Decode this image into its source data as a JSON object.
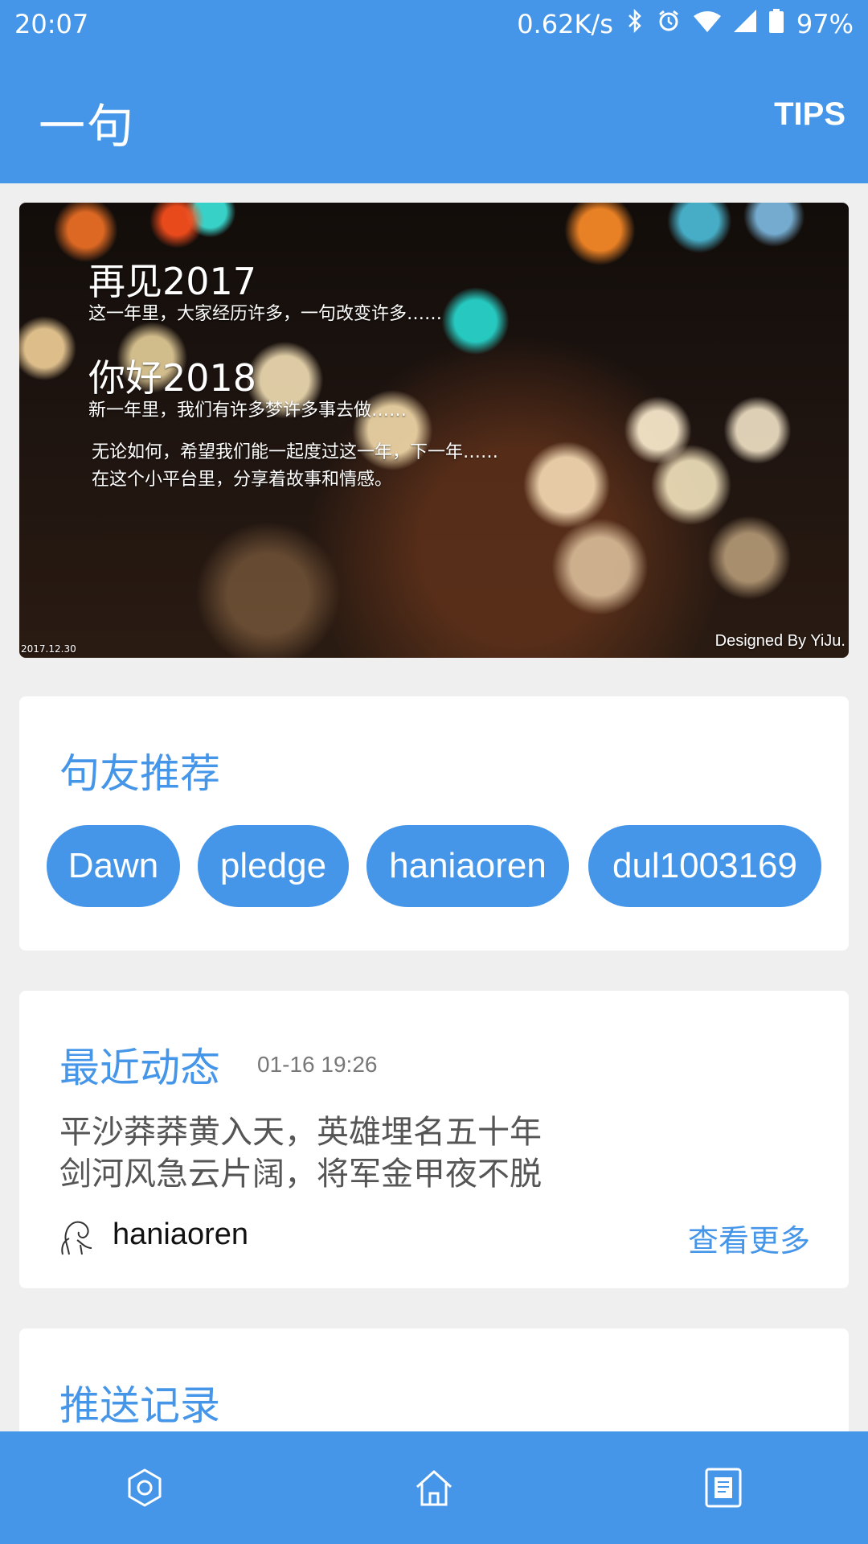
{
  "status_bar": {
    "time": "20:07",
    "network_speed": "0.62K/s",
    "battery": "97%",
    "icons": [
      "bluetooth-icon",
      "alarm-icon",
      "wifi-icon",
      "signal-icon",
      "battery-icon"
    ]
  },
  "app_bar": {
    "title": "一句",
    "action": "TIPS"
  },
  "banner": {
    "line1": "再见2017",
    "line2": "这一年里，大家经历许多，一句改变许多……",
    "line3": "你好2018",
    "line4": "新一年里，我们有许多梦许多事去做……",
    "line5": "无论如何，希望我们能一起度过这一年，下一年……",
    "line6": "在这个小平台里，分享着故事和情感。",
    "date": "2017.12.30",
    "designer": "Designed By YiJu."
  },
  "recommend": {
    "title": "句友推荐",
    "users": [
      "Dawn",
      "pledge",
      "haniaoren",
      "dul1003169"
    ]
  },
  "recent": {
    "title": "最近动态",
    "time": "01-16 19:26",
    "line1": "平沙莽莽黄入天，英雄埋名五十年",
    "line2": "剑河风急云片阔，将军金甲夜不脱",
    "author": "haniaoren",
    "more": "查看更多"
  },
  "push": {
    "title": "推送记录"
  },
  "bottom_nav": {
    "items": [
      "settings-icon",
      "home-icon",
      "notebook-icon"
    ]
  },
  "colors": {
    "primary": "#4596e8",
    "background": "#efefef",
    "card": "#ffffff"
  }
}
